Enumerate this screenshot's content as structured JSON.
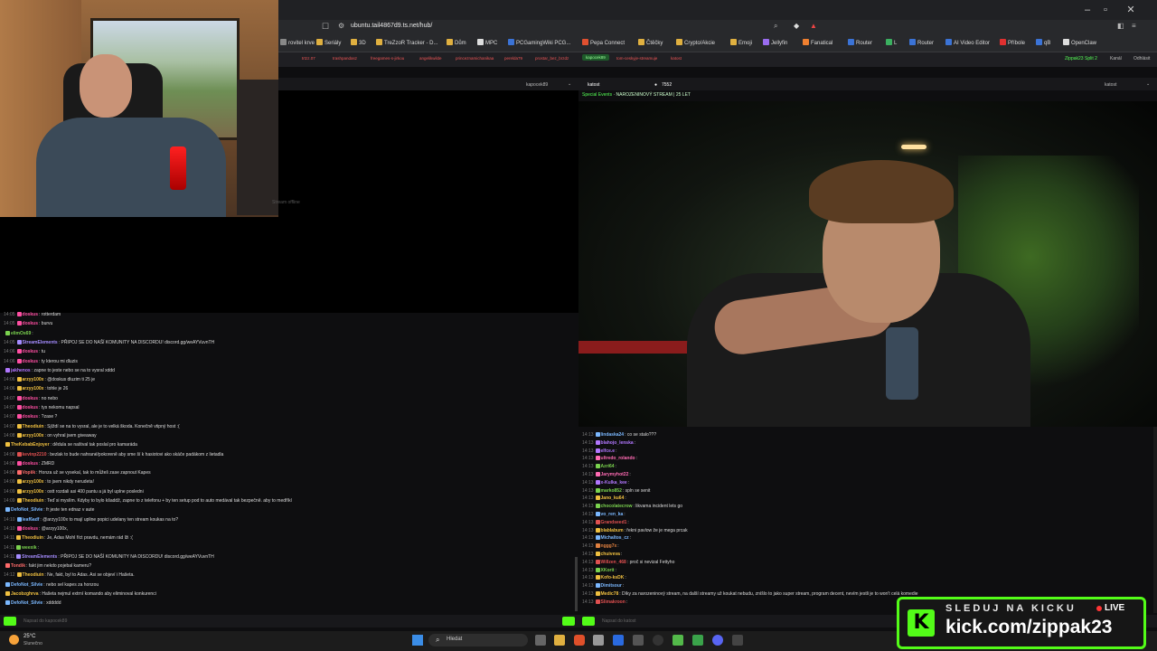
{
  "browser": {
    "url": "ubuntu.tail4867d9.ts.net/hub/",
    "bookmarks": [
      {
        "label": "rovitel krve",
        "color": "#888"
      },
      {
        "label": "Seriály",
        "color": "#e0b040"
      },
      {
        "label": "3D",
        "color": "#e0b040"
      },
      {
        "label": "TreZzoR Tracker - D...",
        "color": "#e0b040"
      },
      {
        "label": "Dům",
        "color": "#e0b040"
      },
      {
        "label": "MPC",
        "color": "#ddd"
      },
      {
        "label": "PCGamingWiki PCG...",
        "color": "#3b73d6"
      },
      {
        "label": "Pepa Connect",
        "color": "#e05030"
      },
      {
        "label": "Čtěčky",
        "color": "#e0b040"
      },
      {
        "label": "Crypto/Akcie",
        "color": "#e0b040"
      },
      {
        "label": "Emoji",
        "color": "#e0b040"
      },
      {
        "label": "Jellyfin",
        "color": "#9a6cf0"
      },
      {
        "label": "Fanatical",
        "color": "#f08030"
      },
      {
        "label": "Router",
        "color": "#3b73d6"
      },
      {
        "label": "L",
        "color": "#3bb060"
      },
      {
        "label": "Router",
        "color": "#3b73d6"
      },
      {
        "label": "AI Video Editor",
        "color": "#3b73d6"
      },
      {
        "label": "Příbole",
        "color": "#e03030"
      },
      {
        "label": "qB",
        "color": "#3b73d6"
      },
      {
        "label": "OpenClaw",
        "color": "#ddd"
      }
    ],
    "tabs2": [
      "trtzz.07",
      "trashpandasz",
      "freegames-s-jirkou",
      "angelikwilde",
      "princeznamichanikaa",
      "perelda79",
      "prostar_bez_brzdz",
      "kapocek89",
      "tom-ceskyje-streamuje",
      "katost"
    ],
    "active_tab2": "kapocek89",
    "hub_labels": {
      "left_select": "kapocek89",
      "right_title": "katost",
      "viewers": "7552",
      "right_select": "katost",
      "right_info": "NAROZENINOVÝ STREAM | 25 LET",
      "special_event": "Special Events",
      "nav_right": [
        "Zippak23",
        "Split 2",
        "Kanál",
        "Odhlásit"
      ]
    },
    "left_offline": "Stream offline"
  },
  "left_chat": [
    {
      "ts": "14:05",
      "user": "doskus",
      "ucol": "#ff4fa3",
      "msg": ": rotterdam"
    },
    {
      "ts": "14:05",
      "user": "doskus",
      "ucol": "#ff4fa3",
      "msg": ": burvu"
    },
    {
      "ts": "",
      "user": "elimOs69",
      "ucol": "#7bd34f",
      "msg": ":"
    },
    {
      "ts": "14:05",
      "user": "StreamElements",
      "ucol": "#a58cff",
      "msg": ": PŘIPOJ SE DO NAŠÍ KOMUNITY NA DISCORDU! discord.gg/weAYVuvnTH"
    },
    {
      "ts": "14:06",
      "user": "doskus",
      "ucol": "#ff4fa3",
      "msg": ": tu"
    },
    {
      "ts": "14:06",
      "user": "doskus",
      "ucol": "#ff4fa3",
      "msg": ": ty kterou mi dluzis"
    },
    {
      "ts": "",
      "user": "jakhenos",
      "ucol": "#b277ff",
      "msg": ": zapne to jeste nebo se na to vysral xddd"
    },
    {
      "ts": "14:06",
      "user": "arzyy100x",
      "ucol": "#f0c040",
      "msg": ": @doskus dluzim ti 25 je"
    },
    {
      "ts": "14:06",
      "user": "arzyy100x",
      "ucol": "#f0c040",
      "msg": ": tohle je 26"
    },
    {
      "ts": "14:07",
      "user": "doskus",
      "ucol": "#ff4fa3",
      "msg": ": no nebo"
    },
    {
      "ts": "14:07",
      "user": "doskus",
      "ucol": "#ff4fa3",
      "msg": ": tys nekomu napsal"
    },
    {
      "ts": "14:07",
      "user": "doskus",
      "ucol": "#ff4fa3",
      "msg": ": ?zase ?"
    },
    {
      "ts": "14:07",
      "user": "Theodiuin",
      "ucol": "#f0c040",
      "msg": ": Sjíždí se na to vysral, ale je to velká škoda. Konečně vtipný host :("
    },
    {
      "ts": "14:08",
      "user": "arzyy100x",
      "ucol": "#f0c040",
      "msg": ": on vyhral jsem giveaway"
    },
    {
      "ts": "",
      "user": "TheKebabEnjoyer",
      "ucol": "#f0c040",
      "msg": ": dědula se naštval tak poslal pro kamaráda"
    },
    {
      "ts": "14:08",
      "user": "kevinp2210",
      "ucol": "#e05050",
      "msg": ": bezlak to bude nahrané/pokoreně aby sme ší k hasiotovi ako skáče padákom z lietadla"
    },
    {
      "ts": "14:08",
      "user": "doskus",
      "ucol": "#ff4fa3",
      "msg": ": ZMRD"
    },
    {
      "ts": "14:08",
      "user": "Vopiik",
      "ucol": "#ff6b6b",
      "msg": ": Honza už se vysekal, tak to můžeš zase zapnout Kapes"
    },
    {
      "ts": "14:09",
      "user": "arzyy100x",
      "ucol": "#f0c040",
      "msg": ": to jsem nikdy nerudeta!"
    },
    {
      "ts": "14:09",
      "user": "arzyy100x",
      "ucol": "#f0c040",
      "msg": ": ostt rozdali asi 400 pantu a já byl uplne posledni"
    },
    {
      "ts": "14:09",
      "user": "Theodiuin",
      "ucol": "#f0c040",
      "msg": ": Teď si myslím. Kdyby to bylo kšaddž, zapne to z telefonu + by ten setup pod to auto medával tak bezpečně. aby to medříkl"
    },
    {
      "ts": "",
      "user": "DefoNot_Silvie",
      "ucol": "#7bb8ff",
      "msg": ": fr jeste ten ednaz v aute"
    },
    {
      "ts": "14:10",
      "user": "leaf6adf",
      "ucol": "#7bb8ff",
      "msg": ": @arzyy100x to mají upline popici udelany ten stream koukas na to?"
    },
    {
      "ts": "14:10",
      "user": "doskus",
      "ucol": "#ff4fa3",
      "msg": ": @arzyy100x,"
    },
    {
      "ts": "14:11",
      "user": "Theodiuin",
      "ucol": "#f0c040",
      "msg": ": Je, Adas Mohl říct pravdu, nemám rád lži :("
    },
    {
      "ts": "14:11",
      "user": "weexik",
      "ucol": "#7bd34f",
      "msg": ":"
    },
    {
      "ts": "14:11",
      "user": "StreamElements",
      "ucol": "#a58cff",
      "msg": ": PŘIPOJ SE DO NAŠÍ KOMUNITY NA DISCORDU! discord.gg/weAYVuvnTH"
    },
    {
      "ts": "",
      "user": "Tondik",
      "ucol": "#ff6b6b",
      "msg": ": fakt jim nekdo pojebal kameru?"
    },
    {
      "ts": "14:12",
      "user": "Theodiuin",
      "ucol": "#f0c040",
      "msg": ": Ne, fakt, byl to Adas. Asi se objeví i Hašeta."
    },
    {
      "ts": "",
      "user": "DefoNot_Silvie",
      "ucol": "#7bb8ff",
      "msg": ": nebo sel kapes za honzou"
    },
    {
      "ts": "",
      "user": "Jacobzghrva",
      "ucol": "#f0c040",
      "msg": ": Hašeta nejmul extrní komando aby eliminoval konkurenci"
    },
    {
      "ts": "",
      "user": "DefoNot_Silvie",
      "ucol": "#7bb8ff",
      "msg": ": xddddd"
    }
  ],
  "right_chat": [
    {
      "ts": "14:13",
      "user": "lindaska24",
      "ucol": "#7bb8ff",
      "msg": ": co se stalo???"
    },
    {
      "ts": "14:13",
      "user": "blahojo_lenska",
      "ucol": "#b277ff",
      "msg": ":"
    },
    {
      "ts": "14:13",
      "user": "elfce.e",
      "ucol": "#b277ff",
      "msg": ":"
    },
    {
      "ts": "14:13",
      "user": "ultredo_rolando",
      "ucol": "#ff6bb3",
      "msg": ":"
    },
    {
      "ts": "14:13",
      "user": "Azri64",
      "ucol": "#7bd34f",
      "msg": ":"
    },
    {
      "ts": "14:13",
      "user": "Jarymyhot22",
      "ucol": "#ff6bb3",
      "msg": ":"
    },
    {
      "ts": "14:13",
      "user": "x-Kulka_kee",
      "ucol": "#b277ff",
      "msg": ":"
    },
    {
      "ts": "14:13",
      "user": "marko852",
      "ucol": "#7bd34f",
      "msg": ": spln se senit"
    },
    {
      "ts": "14:13",
      "user": "Jano_ku64",
      "ucol": "#f0c040",
      "msg": ":"
    },
    {
      "ts": "14:13",
      "user": "chocolatecrow",
      "ucol": "#7bd34f",
      "msg": ": likvama incident lets go"
    },
    {
      "ts": "14:13",
      "user": "vo_ren_ka",
      "ucol": "#7bb8ff",
      "msg": ":"
    },
    {
      "ts": "14:13",
      "user": "Grandseed1",
      "ucol": "#e05050",
      "msg": ":"
    },
    {
      "ts": "14:13",
      "user": "blablabum",
      "ucol": "#f0c040",
      "msg": ": řekni pavlow že je mega prcak"
    },
    {
      "ts": "14:13",
      "user": "Michaltos_cz",
      "ucol": "#7bb8ff",
      "msg": ":"
    },
    {
      "ts": "14:13",
      "user": "nggg7x",
      "ucol": "#e08040",
      "msg": ":"
    },
    {
      "ts": "14:13",
      "user": "chuiveva",
      "ucol": "#f0c040",
      "msg": ":"
    },
    {
      "ts": "14:13",
      "user": "Willzen_468",
      "ucol": "#e05050",
      "msg": ": proč si nevizal Fettyho"
    },
    {
      "ts": "14:13",
      "user": "XKorit",
      "ucol": "#7bd34f",
      "msg": ":"
    },
    {
      "ts": "14:13",
      "user": "Kofo-ksDK",
      "ucol": "#f0c040",
      "msg": ":"
    },
    {
      "ts": "14:13",
      "user": "Dimitsour",
      "ucol": "#7bb8ff",
      "msg": ":"
    },
    {
      "ts": "14:13",
      "user": "Medic78",
      "ucol": "#f0c040",
      "msg": ": Díky za narozeninový stream, na další streamy už koukat nebudu, zníšlo to jako super stream, program decent, nevím jestli je to won't celá komedie"
    },
    {
      "ts": "14:13",
      "user": "Slimakroon",
      "ucol": "#e05050",
      "msg": ":"
    }
  ],
  "inputs": {
    "left_placeholder": "Napsat do kapocek89",
    "right_placeholder": "Napsat do katost",
    "send_label": "Odeslat"
  },
  "taskbar": {
    "weather_temp": "25°C",
    "weather_desc": "Slunečno",
    "search_label": "Hledat",
    "lang": "CES",
    "time": "14:13",
    "date": "08.08.2025"
  },
  "kick_banner": {
    "top_text": "SLEDUJ NA KICKU",
    "url": "kick.com/zippak23",
    "live": "LIVE",
    "logo": "K"
  },
  "colors": {
    "kick_green": "#53fc18",
    "bg": "#0e0e10"
  }
}
